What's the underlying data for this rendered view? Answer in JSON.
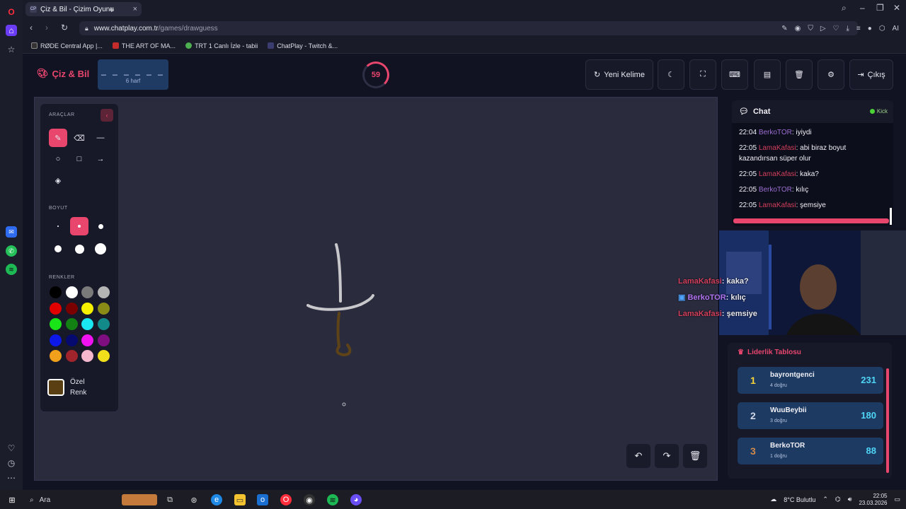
{
  "browser": {
    "tab_title": "Çiz & Bil - Çizim Oyunu",
    "tab_favicon": "CP",
    "url_host": "www.chatplay.com.tr",
    "url_path": "/games/drawguess",
    "ai_label": "AI",
    "bookmarks": [
      "RØDE Central App |...",
      "THE ART OF MA...",
      "TRT 1 Canlı İzle - tabii",
      "ChatPlay - Twitch &..."
    ]
  },
  "header": {
    "logo": "Çiz & Bil",
    "word_blanks": "_ _ _ _ _ _",
    "word_hint": "6 harf",
    "timer": "59",
    "new_word_label": "Yeni Kelime",
    "exit_label": "Çıkış"
  },
  "tools": {
    "section_tools": "ARAÇLAR",
    "section_size": "BOYUT",
    "section_colors": "RENKLER",
    "custom_color_line1": "Özel",
    "custom_color_line2": "Renk",
    "custom_color_value": "#5a3f12",
    "colors": [
      "#000000",
      "#ffffff",
      "#7a7a7a",
      "#b5b5b5",
      "#e00000",
      "#7a0000",
      "#f5f000",
      "#8a8a17",
      "#18e418",
      "#138013",
      "#19e6f0",
      "#138a8a",
      "#0b18e8",
      "#060a6e",
      "#f012f0",
      "#7f0f80",
      "#f0a01a",
      "#a0242c",
      "#f4b7cc",
      "#f2df1c"
    ]
  },
  "chat": {
    "title": "Chat",
    "platform": "Kick",
    "messages": [
      {
        "time": "22:04",
        "user": "BerkoTOR",
        "text": ": iyiydi"
      },
      {
        "time": "22:05",
        "user": "LamaKafasi",
        "text": ": abi biraz boyut kazandırsan süper olur"
      },
      {
        "time": "22:05",
        "user": "LamaKafasi",
        "text": ": kaka?"
      },
      {
        "time": "22:05",
        "user": "BerkoTOR",
        "text": ": kılıç"
      },
      {
        "time": "22:05",
        "user": "LamaKafasi",
        "text": ": şemsiye"
      }
    ]
  },
  "overlay": [
    {
      "user": "LamaKafasi",
      "text": ": kaka?"
    },
    {
      "user": "BerkoTOR",
      "text": ": kılıç"
    },
    {
      "user": "LamaKafasi",
      "text": ": şemsiye"
    }
  ],
  "leaderboard": {
    "title": "Liderlik Tablosu",
    "rows": [
      {
        "rank": "1",
        "name": "bayrontgenci",
        "sub": "4 doğru",
        "score": "231",
        "rank_color": "#f5d33a"
      },
      {
        "rank": "2",
        "name": "WuuBeybii",
        "sub": "3 doğru",
        "score": "180",
        "rank_color": "#cfd6e4"
      },
      {
        "rank": "3",
        "name": "BerkoTOR",
        "sub": "1 doğru",
        "score": "88",
        "rank_color": "#d08a4a"
      }
    ]
  },
  "taskbar": {
    "search_label": "Ara",
    "weather": "8°C  Bulutlu",
    "time": "22:05",
    "date": "23.03.2026"
  }
}
